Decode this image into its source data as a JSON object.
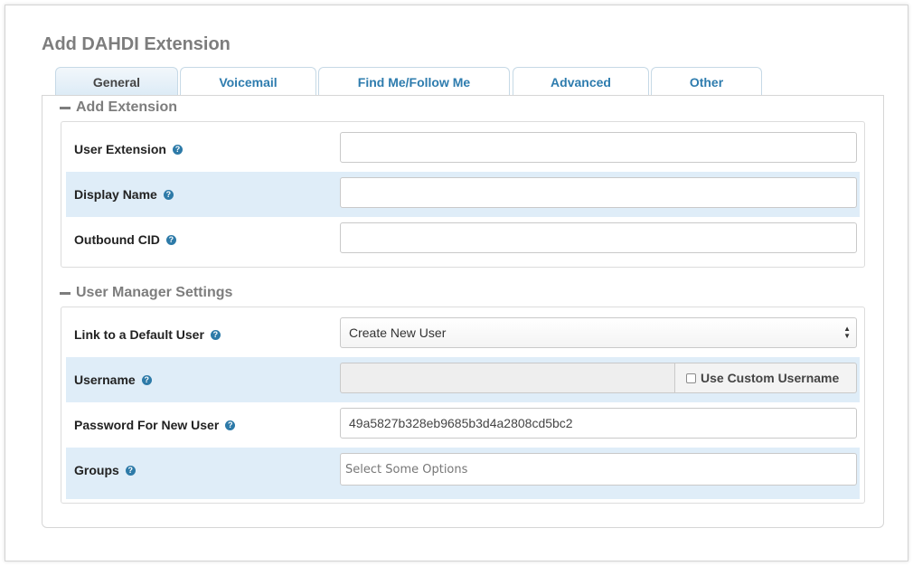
{
  "page": {
    "title": "Add DAHDI Extension"
  },
  "tabs": [
    {
      "label": "General",
      "active": true
    },
    {
      "label": "Voicemail",
      "active": false
    },
    {
      "label": "Find Me/Follow Me",
      "active": false
    },
    {
      "label": "Advanced",
      "active": false
    },
    {
      "label": "Other",
      "active": false
    }
  ],
  "sections": {
    "add_extension": {
      "title": "Add Extension",
      "fields": {
        "user_extension": {
          "label": "User Extension",
          "value": ""
        },
        "display_name": {
          "label": "Display Name",
          "value": ""
        },
        "outbound_cid": {
          "label": "Outbound CID",
          "value": ""
        }
      }
    },
    "user_manager": {
      "title": "User Manager Settings",
      "fields": {
        "link_default_user": {
          "label": "Link to a Default User",
          "selected": "Create New User"
        },
        "username": {
          "label": "Username",
          "value": "",
          "custom_label": "Use Custom Username",
          "custom_checked": false
        },
        "password": {
          "label": "Password For New User",
          "value": "49a5827b328eb9685b3d4a2808cd5bc2"
        },
        "groups": {
          "label": "Groups",
          "placeholder": "Select Some Options"
        }
      }
    }
  },
  "icons": {
    "help": "help-circle-icon",
    "collapse": "minus-icon",
    "select_arrows": "updown-arrows-icon"
  },
  "colors": {
    "tab_text": "#2e7cae",
    "row_highlight": "#dfedf8",
    "help_icon": "#2d7aa8",
    "section_title": "#7d7d7d"
  }
}
